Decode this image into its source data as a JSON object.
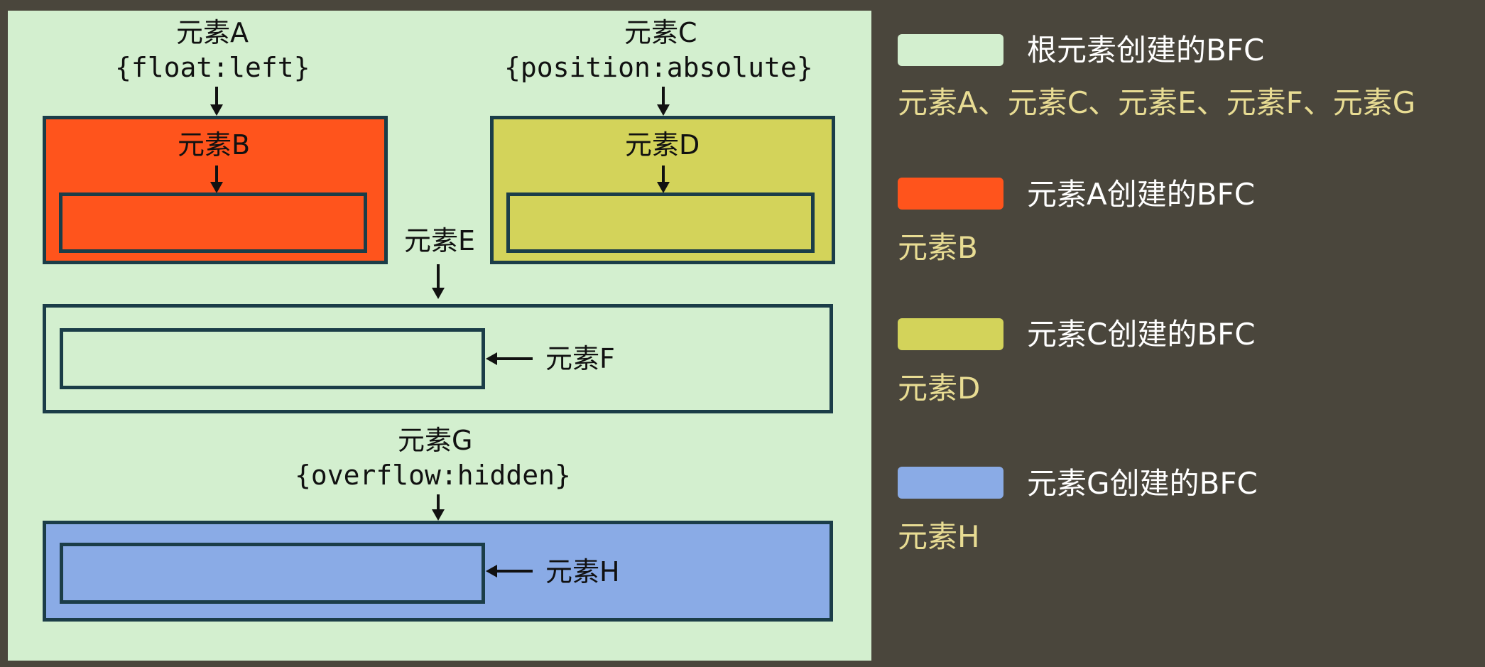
{
  "diagram": {
    "element_a": {
      "name": "元素A",
      "style": "{float:left}"
    },
    "element_b": {
      "name": "元素B"
    },
    "element_c": {
      "name": "元素C",
      "style": "{position:absolute}"
    },
    "element_d": {
      "name": "元素D"
    },
    "element_e": {
      "name": "元素E"
    },
    "element_f": {
      "name": "元素F"
    },
    "element_g": {
      "name": "元素G",
      "style": "{overflow:hidden}"
    },
    "element_h": {
      "name": "元素H"
    }
  },
  "legend": [
    {
      "title": "根元素创建的BFC",
      "items": "元素A、元素C、元素E、元素F、元素G",
      "color": "#d3efcf"
    },
    {
      "title": "元素A创建的BFC",
      "items": "元素B",
      "color": "#ff541c"
    },
    {
      "title": "元素C创建的BFC",
      "items": "元素D",
      "color": "#d3d35a"
    },
    {
      "title": "元素G创建的BFC",
      "items": "元素H",
      "color": "#8aabe6"
    }
  ],
  "colors": {
    "background": "#4a463c",
    "border": "#1b3d48",
    "legend_title": "#ffffff",
    "legend_items": "#e8dc93"
  }
}
